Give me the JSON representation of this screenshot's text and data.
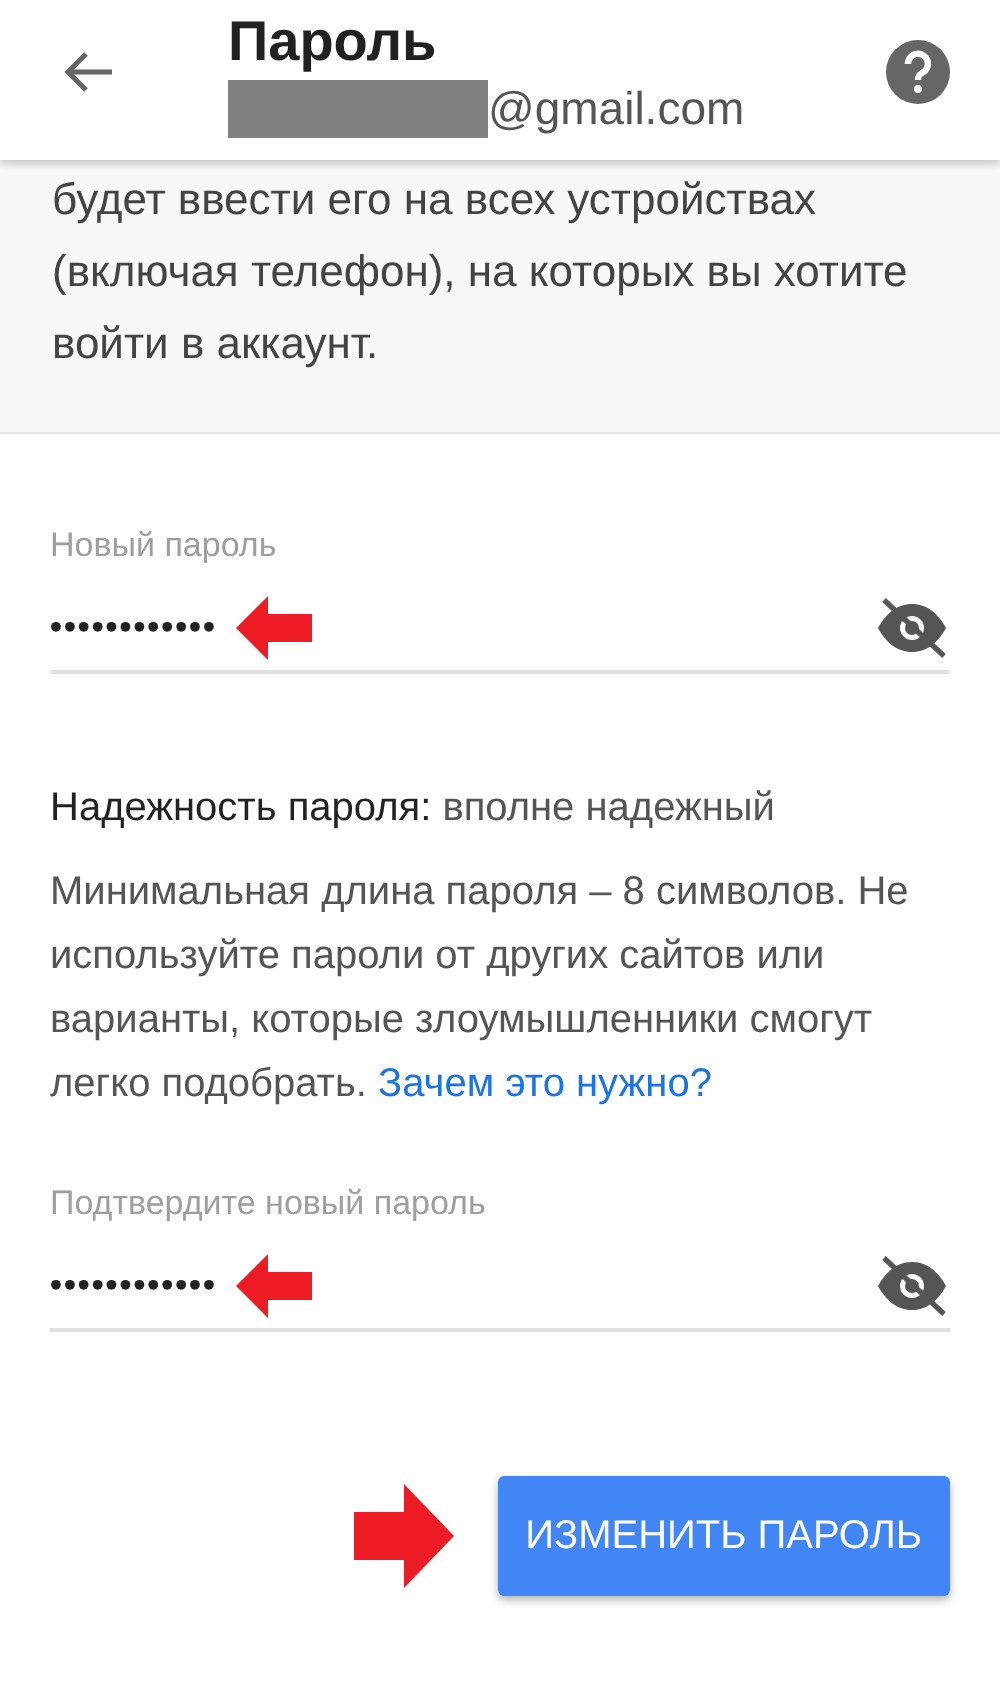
{
  "header": {
    "title": "Пароль",
    "account_suffix": "@gmail.com"
  },
  "intro": "будет ввести его на всех устройствах (включая телефон), на которых вы хотите войти в аккаунт.",
  "fields": [
    {
      "label": "Новый пароль",
      "value": "••••••••••••",
      "visible": false
    },
    {
      "label": "Подтвердите новый пароль",
      "value": "••••••••••••",
      "visible": false
    }
  ],
  "strength": {
    "label": "Надежность пароля:",
    "value": "вполне надежный"
  },
  "hint": {
    "text": "Минимальная длина пароля – 8 символов. Не используйте пароли от других сайтов или варианты, которые злоумышленники смогут легко подобрать.",
    "link": "Зачем это нужно?"
  },
  "button": "ИЗМЕНИТЬ ПАРОЛЬ"
}
